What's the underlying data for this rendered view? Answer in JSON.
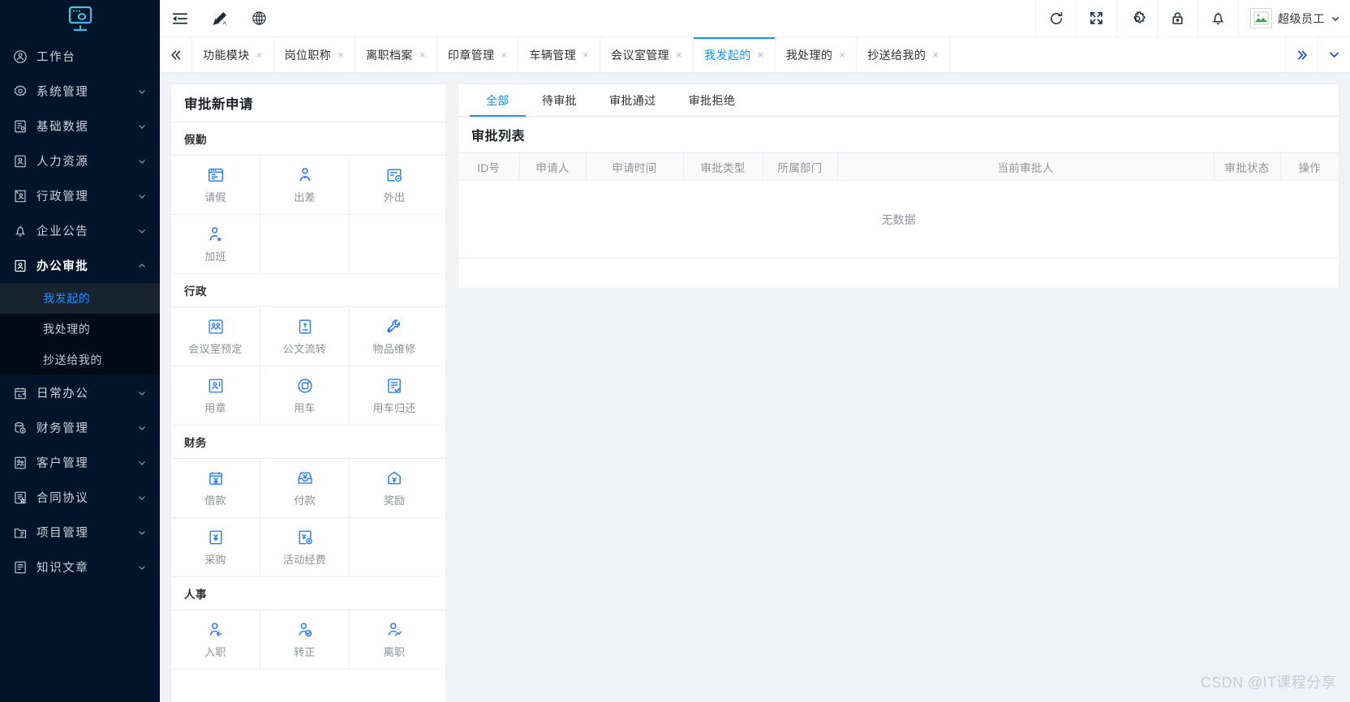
{
  "sidebar": {
    "logo": "monitor-logo",
    "items": [
      {
        "label": "工作台",
        "icon": "dashboard-icon",
        "expandable": false
      },
      {
        "label": "系统管理",
        "icon": "settings-gear-icon",
        "expandable": true
      },
      {
        "label": "基础数据",
        "icon": "database-doc-icon",
        "expandable": true
      },
      {
        "label": "人力资源",
        "icon": "user-box-icon",
        "expandable": true
      },
      {
        "label": "行政管理",
        "icon": "admin-doc-icon",
        "expandable": true
      },
      {
        "label": "企业公告",
        "icon": "bell-icon",
        "expandable": true
      },
      {
        "label": "办公审批",
        "icon": "approval-user-icon",
        "expandable": true,
        "expanded": true
      }
    ],
    "submenu": [
      {
        "label": "我发起的",
        "active": true
      },
      {
        "label": "我处理的",
        "active": false
      },
      {
        "label": "抄送给我的",
        "active": false
      }
    ],
    "items_after": [
      {
        "label": "日常办公",
        "icon": "calendar-check-icon",
        "expandable": true
      },
      {
        "label": "财务管理",
        "icon": "finance-db-icon",
        "expandable": true
      },
      {
        "label": "客户管理",
        "icon": "customer-icon",
        "expandable": true
      },
      {
        "label": "合同协议",
        "icon": "contract-star-icon",
        "expandable": true
      },
      {
        "label": "项目管理",
        "icon": "project-folder-icon",
        "expandable": true
      },
      {
        "label": "知识文章",
        "icon": "article-icon",
        "expandable": true
      }
    ]
  },
  "header": {
    "left_icons": [
      {
        "name": "menu-collapse-icon"
      },
      {
        "name": "theme-brush-icon"
      },
      {
        "name": "language-globe-icon"
      }
    ],
    "right_icons": [
      {
        "name": "refresh-icon"
      },
      {
        "name": "fullscreen-icon"
      },
      {
        "name": "gear-icon"
      },
      {
        "name": "lock-icon"
      },
      {
        "name": "notification-bell-icon"
      }
    ],
    "user": {
      "name": "超级员工",
      "avatar": "broken-image-avatar"
    }
  },
  "tabbar": {
    "scroll_left_icon": "double-chevron-left-icon",
    "scroll_right_icon": "double-chevron-right-icon",
    "dropdown_icon": "chevron-down-icon",
    "close_icon": "×",
    "tabs": [
      {
        "label": "功能模块",
        "active": false
      },
      {
        "label": "岗位职称",
        "active": false
      },
      {
        "label": "离职档案",
        "active": false
      },
      {
        "label": "印章管理",
        "active": false
      },
      {
        "label": "车辆管理",
        "active": false
      },
      {
        "label": "会议室管理",
        "active": false
      },
      {
        "label": "我发起的",
        "active": true
      },
      {
        "label": "我处理的",
        "active": false
      },
      {
        "label": "抄送给我的",
        "active": false
      }
    ]
  },
  "apply_panel": {
    "title": "审批新申请",
    "groups": [
      {
        "title": "假勤",
        "tiles": [
          {
            "label": "请假",
            "icon": "leave-form-icon"
          },
          {
            "label": "出差",
            "icon": "travel-person-icon"
          },
          {
            "label": "外出",
            "icon": "outing-doc-icon"
          },
          {
            "label": "加班",
            "icon": "overtime-person-icon"
          }
        ]
      },
      {
        "title": "行政",
        "tiles": [
          {
            "label": "会议室预定",
            "icon": "meeting-room-icon"
          },
          {
            "label": "公文流转",
            "icon": "document-flow-icon"
          },
          {
            "label": "物品维修",
            "icon": "repair-tools-icon"
          },
          {
            "label": "用章",
            "icon": "seal-use-icon"
          },
          {
            "label": "用车",
            "icon": "car-use-icon"
          },
          {
            "label": "用车归还",
            "icon": "car-return-icon"
          }
        ]
      },
      {
        "title": "财务",
        "tiles": [
          {
            "label": "借款",
            "icon": "loan-yuan-icon"
          },
          {
            "label": "付款",
            "icon": "payment-yuan-icon"
          },
          {
            "label": "奖励",
            "icon": "reward-yuan-icon"
          },
          {
            "label": "采购",
            "icon": "purchase-yuan-icon"
          },
          {
            "label": "活动经费",
            "icon": "activity-fund-icon"
          }
        ]
      },
      {
        "title": "人事",
        "tiles": [
          {
            "label": "入职",
            "icon": "onboard-person-icon"
          },
          {
            "label": "转正",
            "icon": "regular-person-icon"
          },
          {
            "label": "离职",
            "icon": "resign-person-icon"
          }
        ]
      }
    ]
  },
  "list_panel": {
    "filter_tabs": [
      {
        "label": "全部",
        "active": true
      },
      {
        "label": "待审批",
        "active": false
      },
      {
        "label": "审批通过",
        "active": false
      },
      {
        "label": "审批拒绝",
        "active": false
      }
    ],
    "title": "审批列表",
    "columns": [
      "ID号",
      "申请人",
      "申请时间",
      "审批类型",
      "所属部门",
      "当前审批人",
      "审批状态",
      "操作"
    ],
    "rows": [],
    "empty_text": "无数据"
  },
  "watermark": "CSDN @IT课程分享",
  "colors": {
    "sidebar_bg": "#001529",
    "submenu_bg": "#000c17",
    "accent": "#1890ff",
    "tile_icon": "#2f7ef3",
    "page_bg": "#f0f2f5"
  }
}
